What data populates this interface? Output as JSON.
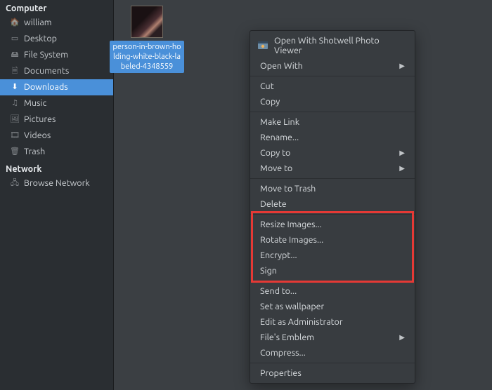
{
  "sidebar": {
    "groups": [
      {
        "header": "Computer",
        "items": [
          {
            "label": "william",
            "icon": "🏠",
            "name": "home"
          },
          {
            "label": "Desktop",
            "icon": "▭",
            "name": "desktop"
          },
          {
            "label": "File System",
            "icon": "🖴",
            "name": "filesystem"
          },
          {
            "label": "Documents",
            "icon": "🗎",
            "name": "documents"
          },
          {
            "label": "Downloads",
            "icon": "⬇",
            "name": "downloads",
            "selected": true
          },
          {
            "label": "Music",
            "icon": "♫",
            "name": "music"
          },
          {
            "label": "Pictures",
            "icon": "🖼",
            "name": "pictures"
          },
          {
            "label": "Videos",
            "icon": "🎞",
            "name": "videos"
          },
          {
            "label": "Trash",
            "icon": "🗑",
            "name": "trash"
          }
        ]
      },
      {
        "header": "Network",
        "items": [
          {
            "label": "Browse Network",
            "icon": "🖧",
            "name": "browse-network"
          }
        ]
      }
    ]
  },
  "file": {
    "label": "person-in-brown-holding-white-black-labeled-4348559"
  },
  "context_menu": {
    "open_with_app": "Open With Shotwell Photo Viewer",
    "open_with": "Open With",
    "cut": "Cut",
    "copy": "Copy",
    "make_link": "Make Link",
    "rename": "Rename...",
    "copy_to": "Copy to",
    "move_to": "Move to",
    "move_to_trash": "Move to Trash",
    "delete": "Delete",
    "resize_images": "Resize Images...",
    "rotate_images": "Rotate Images...",
    "encrypt": "Encrypt...",
    "sign": "Sign",
    "send_to": "Send to...",
    "set_as_wallpaper": "Set as wallpaper",
    "edit_as_admin": "Edit as Administrator",
    "files_emblem": "File's Emblem",
    "compress": "Compress...",
    "properties": "Properties"
  }
}
